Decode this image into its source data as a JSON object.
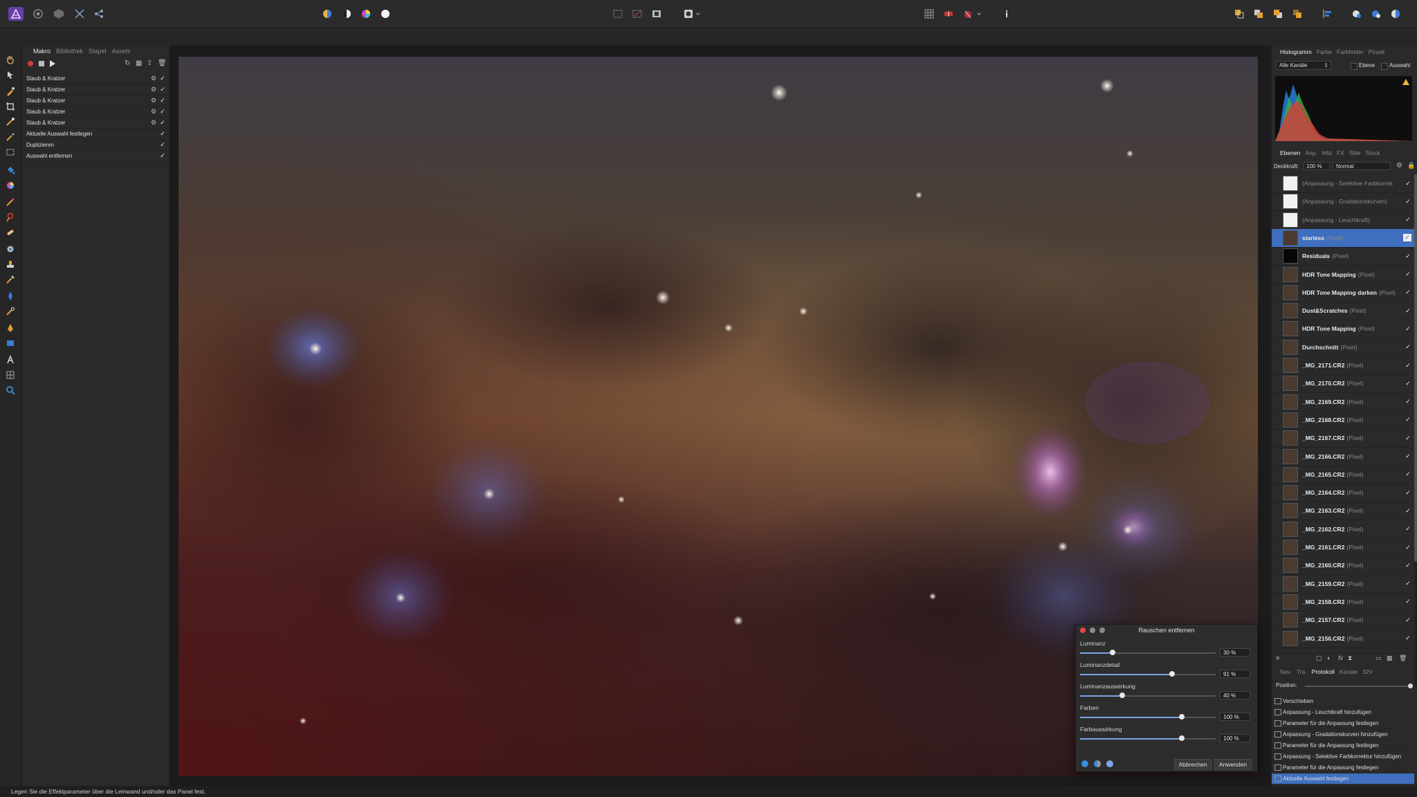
{
  "macro_panel": {
    "tabs": [
      {
        "label": "Makro",
        "active": true
      },
      {
        "label": "Bibliothek",
        "active": false
      },
      {
        "label": "Stapel",
        "active": false
      },
      {
        "label": "Assets",
        "active": false
      }
    ],
    "items": [
      {
        "label": "Staub & Kratzer",
        "has_settings": true
      },
      {
        "label": "Staub & Kratzer",
        "has_settings": true
      },
      {
        "label": "Staub & Kratzer",
        "has_settings": true
      },
      {
        "label": "Staub & Kratzer",
        "has_settings": true
      },
      {
        "label": "Staub & Kratzer",
        "has_settings": true
      },
      {
        "label": "Aktuelle Auswahl festlegen",
        "has_settings": false
      },
      {
        "label": "Duplizieren",
        "has_settings": false
      },
      {
        "label": "Auswahl entfernen",
        "has_settings": false
      }
    ],
    "check_glyph": "✓",
    "gear_glyph": "⚙"
  },
  "histogram_panel": {
    "tabs": [
      {
        "label": "Histogramm",
        "active": true
      },
      {
        "label": "Farbe",
        "active": false
      },
      {
        "label": "Farbfelder",
        "active": false
      },
      {
        "label": "Pinsel",
        "active": false
      }
    ],
    "channel_select": "Alle Kanäle",
    "option_layer": "Ebene",
    "option_selection": "Auswahl",
    "warning_icon": "warning-triangle-icon"
  },
  "layers_panel": {
    "tabs": [
      {
        "label": "Ebenen",
        "active": true
      },
      {
        "label": "Anp.",
        "active": false
      },
      {
        "label": "Mtd",
        "active": false
      },
      {
        "label": "FX",
        "active": false
      },
      {
        "label": "Stile",
        "active": false
      },
      {
        "label": "Stock",
        "active": false
      }
    ],
    "opacity_label": "Deckkraft:",
    "opacity_value": "100 %",
    "blend_mode": "Normal",
    "layers": [
      {
        "name": "(Anpassung - Selektive Farbkorrek",
        "type": "",
        "thumb": "white",
        "adjustment": true,
        "selected": false
      },
      {
        "name": "(Anpassung - Gradationskurven)",
        "type": "",
        "thumb": "white",
        "adjustment": true,
        "selected": false
      },
      {
        "name": "(Anpassung - Leuchtkraft)",
        "type": "",
        "thumb": "white",
        "adjustment": true,
        "selected": false
      },
      {
        "name": "starless",
        "type": "(Pixel)",
        "thumb": "photo",
        "adjustment": false,
        "selected": true
      },
      {
        "name": "Residuals",
        "type": "(Pixel)",
        "thumb": "black",
        "adjustment": false,
        "selected": false
      },
      {
        "name": "HDR Tone Mapping",
        "type": "(Pixel)",
        "thumb": "photo",
        "adjustment": false,
        "selected": false
      },
      {
        "name": "HDR Tone Mapping darken",
        "type": "(Pixel)",
        "thumb": "photo",
        "adjustment": false,
        "selected": false
      },
      {
        "name": "Dust&Scratches",
        "type": "(Pixel)",
        "thumb": "photo",
        "adjustment": false,
        "selected": false
      },
      {
        "name": "HDR Tone Mapping",
        "type": "(Pixel)",
        "thumb": "photo",
        "adjustment": false,
        "selected": false
      },
      {
        "name": "Durchschnitt",
        "type": "(Pixel)",
        "thumb": "photo",
        "adjustment": false,
        "selected": false
      },
      {
        "name": "_MG_2171.CR2",
        "type": "(Pixel)",
        "thumb": "photo",
        "adjustment": false,
        "selected": false
      },
      {
        "name": "_MG_2170.CR2",
        "type": "(Pixel)",
        "thumb": "photo",
        "adjustment": false,
        "selected": false
      },
      {
        "name": "_MG_2169.CR2",
        "type": "(Pixel)",
        "thumb": "photo",
        "adjustment": false,
        "selected": false
      },
      {
        "name": "_MG_2168.CR2",
        "type": "(Pixel)",
        "thumb": "photo",
        "adjustment": false,
        "selected": false
      },
      {
        "name": "_MG_2167.CR2",
        "type": "(Pixel)",
        "thumb": "photo",
        "adjustment": false,
        "selected": false
      },
      {
        "name": "_MG_2166.CR2",
        "type": "(Pixel)",
        "thumb": "photo",
        "adjustment": false,
        "selected": false
      },
      {
        "name": "_MG_2165.CR2",
        "type": "(Pixel)",
        "thumb": "photo",
        "adjustment": false,
        "selected": false
      },
      {
        "name": "_MG_2164.CR2",
        "type": "(Pixel)",
        "thumb": "photo",
        "adjustment": false,
        "selected": false
      },
      {
        "name": "_MG_2163.CR2",
        "type": "(Pixel)",
        "thumb": "photo",
        "adjustment": false,
        "selected": false
      },
      {
        "name": "_MG_2162.CR2",
        "type": "(Pixel)",
        "thumb": "photo",
        "adjustment": false,
        "selected": false
      },
      {
        "name": "_MG_2161.CR2",
        "type": "(Pixel)",
        "thumb": "photo",
        "adjustment": false,
        "selected": false
      },
      {
        "name": "_MG_2160.CR2",
        "type": "(Pixel)",
        "thumb": "photo",
        "adjustment": false,
        "selected": false
      },
      {
        "name": "_MG_2159.CR2",
        "type": "(Pixel)",
        "thumb": "photo",
        "adjustment": false,
        "selected": false
      },
      {
        "name": "_MG_2158.CR2",
        "type": "(Pixel)",
        "thumb": "photo",
        "adjustment": false,
        "selected": false
      },
      {
        "name": "_MG_2157.CR2",
        "type": "(Pixel)",
        "thumb": "photo",
        "adjustment": false,
        "selected": false
      },
      {
        "name": "_MG_2156.CR2",
        "type": "(Pixel)",
        "thumb": "photo",
        "adjustment": false,
        "selected": false
      }
    ]
  },
  "history_panel": {
    "tabs": [
      {
        "label": "Nav.",
        "active": false
      },
      {
        "label": "Tra.",
        "active": false
      },
      {
        "label": "Protokoll",
        "active": true
      },
      {
        "label": "Kanäle",
        "active": false
      },
      {
        "label": "32V",
        "active": false
      }
    ],
    "position_label": "Position:",
    "position_fraction": 1.0,
    "entries": [
      {
        "label": "Verschieben",
        "selected": false
      },
      {
        "label": "Anpassung - Leuchtkraft hinzufügen",
        "selected": false
      },
      {
        "label": "Parameter für die Anpassung festlegen",
        "selected": false
      },
      {
        "label": "Anpassung - Gradationskurven hinzufügen",
        "selected": false
      },
      {
        "label": "Parameter für die Anpassung festlegen",
        "selected": false
      },
      {
        "label": "Anpassung - Selektive Farbkorrektur hinzufügen",
        "selected": false
      },
      {
        "label": "Parameter für die Anpassung festlegen",
        "selected": false
      },
      {
        "label": "Aktuelle Auswahl festlegen",
        "selected": true
      }
    ]
  },
  "noise_dialog": {
    "title": "Rauschen entfernen",
    "sliders": [
      {
        "label": "Luminanz",
        "value_text": "30 %",
        "fraction": 0.24
      },
      {
        "label": "Luminanzdetail",
        "value_text": "91 %",
        "fraction": 0.68
      },
      {
        "label": "Luminanzauswirkung",
        "value_text": "40 %",
        "fraction": 0.31
      },
      {
        "label": "Farben",
        "value_text": "100 %",
        "fraction": 0.75
      },
      {
        "label": "Farbauswirkung",
        "value_text": "100 %",
        "fraction": 0.75
      }
    ],
    "cancel_label": "Abbrechen",
    "apply_label": "Anwenden"
  },
  "status_bar": {
    "text": "Legen Sie die Effektparameter über die Leinwand und/oder das Panel fest."
  },
  "colors": {
    "accent": "#3f6fbe",
    "panel": "#2a2a2a",
    "toolbar": "#2b2b2b"
  }
}
